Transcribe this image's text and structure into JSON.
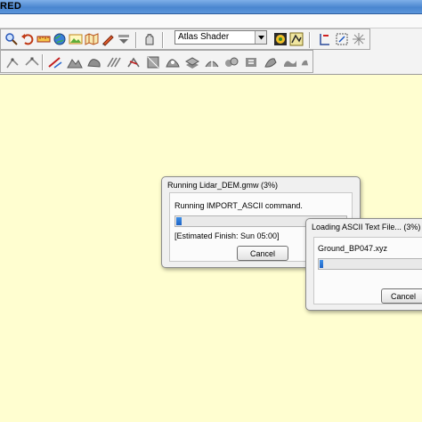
{
  "window": {
    "title": "RED"
  },
  "toolbar": {
    "shader_value": "Atlas Shader",
    "row1_icons": [
      "zoom-icon",
      "undo-icon",
      "ruler-icon",
      "globe-icon",
      "image-icon",
      "map-icon",
      "pen-icon",
      "chevron-down-icon",
      "hand-icon"
    ],
    "row1_right_icons": [
      "shader-palette-icon",
      "shader-settings-icon",
      "line-tool-icon",
      "measure-icon",
      "grid-icon"
    ],
    "row2_icons": [
      "digitize-icon",
      "edit-vertex-icon",
      "draw-line-icon",
      "terrain-icon",
      "area-icon",
      "feature-icon",
      "cut-icon",
      "shape-icon",
      "lidar-icon",
      "layer-icon",
      "split-icon",
      "merge-icon",
      "select-icon",
      "delete-icon",
      "smooth-icon",
      "simplify-icon"
    ]
  },
  "dialog_main": {
    "title": "Running Lidar_DEM.gmw (3%)",
    "message": "Running IMPORT_ASCII command.",
    "progress": 0.03,
    "estimate": "[Estimated Finish: Sun 05:00]",
    "cancel_label": "Cancel"
  },
  "dialog_load": {
    "title": "Loading ASCII Text File... (3%)",
    "file": "Ground_BP047.xyz",
    "progress": 0.03,
    "cancel_label": "Cancel"
  },
  "colors": {
    "workspace": "#fffed0",
    "progress_fill": "#2a75d6",
    "titlebar": "#4a86d0"
  }
}
